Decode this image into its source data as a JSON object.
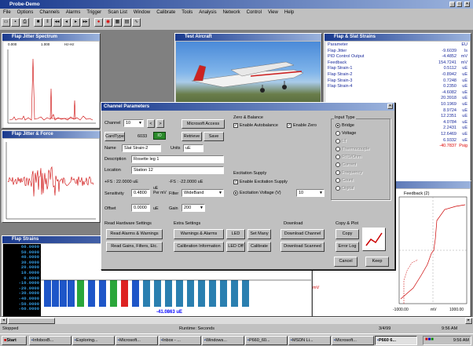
{
  "app": {
    "title": "Probe-Demo"
  },
  "menu": [
    "File",
    "Options",
    "Channels",
    "Alarms",
    "Trigger",
    "Scan List",
    "Window",
    "Calibrate",
    "Tools",
    "Analysis",
    "Network",
    "Control",
    "View",
    "Help"
  ],
  "toolbar_icons": [
    "open-icon",
    "save-icon",
    "print-icon",
    "stop-icon",
    "pause-icon",
    "rewind-icon",
    "step-back-icon",
    "step-forward-icon",
    "fast-forward-icon",
    "record-icon",
    "alarm-icon",
    "grid-icon",
    "chart-icon",
    "scope-icon"
  ],
  "windows": {
    "jitter": {
      "title": "Flap Jitter Spectrum",
      "readout_left": "0.000",
      "readout_mid": "1.000",
      "readout_right": "Hz-Hz"
    },
    "aircraft": {
      "title": "Test Aircraft"
    },
    "strain": {
      "title": "Flap & Slat Strains",
      "header": {
        "name": "Parameter",
        "unit": "EU"
      },
      "rows": [
        {
          "name": "Flap Jitter",
          "value": "-9.6039",
          "unit": "ls"
        },
        {
          "name": "PID Control Output",
          "value": "-4.4852",
          "unit": "mV"
        },
        {
          "name": "Feedback",
          "value": "154.7241",
          "unit": "mV"
        },
        {
          "name": "Flap Strain-1",
          "value": "0.5112",
          "unit": "uE"
        },
        {
          "name": "Flap Strain-2",
          "value": "-0.8942",
          "unit": "uE"
        },
        {
          "name": "Flap Strain-3",
          "value": "0.7248",
          "unit": "uE"
        },
        {
          "name": "Flap Strain-4",
          "value": "0.2350",
          "unit": "uE"
        },
        {
          "name": "",
          "value": "-4.6082",
          "unit": "uE"
        },
        {
          "name": "",
          "value": "20.3918",
          "unit": "uE"
        },
        {
          "name": "",
          "value": "10.1969",
          "unit": "uE"
        },
        {
          "name": "",
          "value": "8.9724",
          "unit": "uE"
        },
        {
          "name": "",
          "value": "12.2351",
          "unit": "uE"
        },
        {
          "name": "",
          "value": "4.0784",
          "unit": "uE"
        },
        {
          "name": "",
          "value": "2.2431",
          "unit": "uE"
        },
        {
          "name": "",
          "value": "12.6469",
          "unit": "uE"
        },
        {
          "name": "",
          "value": "6.9332",
          "unit": "uE"
        },
        {
          "name": "",
          "value": "-40.7837",
          "unit": "Psig"
        }
      ]
    },
    "force": {
      "title": "Flap Jitter & Force"
    },
    "feedback": {
      "title": "",
      "legend": "Feedback (2)",
      "axis_left": "-1000.00",
      "axis_mid": "mV",
      "axis_right": "1000.00",
      "side_label": "mV"
    },
    "bars": {
      "title": "Flap Strains",
      "labels": [
        "60.0000",
        "50.0000",
        "40.0000",
        "30.0000",
        "20.0000",
        "10.0000",
        "0.0000",
        "-10.0000",
        "-20.0000",
        "-30.0000",
        "-40.0000",
        "-50.0000",
        "-60.0000"
      ],
      "footer": "-41.0863 uE"
    }
  },
  "dialog": {
    "title": "Channel Parameters",
    "channel_label": "Channel",
    "channel_value": "10",
    "microsoft_access": "Microsoft Access",
    "cardtype_label": "CardType",
    "cardtype_value": "6033",
    "cardtype_badge": "IO",
    "retrieve": "Retrieve",
    "save": "Save",
    "name_label": "Name",
    "name_value": "Slat Strain-2",
    "units_label": "Units",
    "units_value": "uE",
    "description_label": "Description",
    "description_value": "Rosette leg 1",
    "location_label": "Location",
    "location_value": "Station 12",
    "plus_fs": "+FS : 22.0000 uE",
    "minus_fs": "-FS : -22.0000 uE",
    "sensitivity_label": "Sensitivity",
    "sensitivity_value": "0.4800",
    "sensitivity_unit": "uE\nPer mV",
    "filter_label": "Filter",
    "filter_value": "WideBand",
    "offset_label": "Offset",
    "offset_value": "0.0000",
    "offset_unit": "uE",
    "gain_label": "Gain",
    "gain_value": "200",
    "zero_group": "Zero & Balance",
    "enable_autobalance": "Enable Autobalance",
    "enable_zero": "Enable Zero",
    "excitation_group": "Excitation Supply",
    "enable_excitation": "Enable Excitation Supply",
    "excitation_voltage": "Excitation Voltage (V)",
    "excitation_value": "10",
    "input_type_group": "Input Type",
    "input_types": [
      {
        "label": "Bridge",
        "selected": true,
        "enabled": true
      },
      {
        "label": "Voltage",
        "selected": false,
        "enabled": true
      },
      {
        "label": "LT",
        "selected": false,
        "enabled": false
      },
      {
        "label": "Thermocouple",
        "selected": false,
        "enabled": false
      },
      {
        "label": "RTD/Ohm",
        "selected": false,
        "enabled": false
      },
      {
        "label": "Current",
        "selected": false,
        "enabled": false
      },
      {
        "label": "Frequency",
        "selected": false,
        "enabled": false
      },
      {
        "label": "Count",
        "selected": false,
        "enabled": false
      },
      {
        "label": "Digital",
        "selected": false,
        "enabled": false
      }
    ],
    "read_hw_group": "Read Hardware Settings",
    "read_alarms": "Read Alarms & Warnings",
    "read_gains": "Read Gains, Filters, Etc.",
    "extra_group": "Extra Settings",
    "warnings_alarms": "Warnings & Alarms",
    "led": "LED",
    "set_many": "Set Many",
    "calibration_info": "Calibration Information",
    "led_off": "LED Off",
    "calibrate": "Calibrate",
    "download_group": "Download",
    "download_channel": "Download Channel",
    "download_scanned": "Download Scanned",
    "copy_group": "Copy & Plot",
    "copy": "Copy",
    "error_log": "Error Log",
    "cancel": "Cancel",
    "keep": "Keep"
  },
  "statusbar": {
    "left": "Stopped",
    "mid": "Runtime: Seconds",
    "date": "3/4/99",
    "time": "9:56 AM"
  },
  "taskbar": {
    "start": "Start",
    "tasks": [
      "InfoboxB...",
      "Exploring...",
      "Microsoft...",
      "Inbox - ...",
      "Windows...",
      "P660_60...",
      "MSDN Li...",
      "Microsoft...",
      "P660 6..."
    ],
    "clock": "9:56 AM"
  }
}
